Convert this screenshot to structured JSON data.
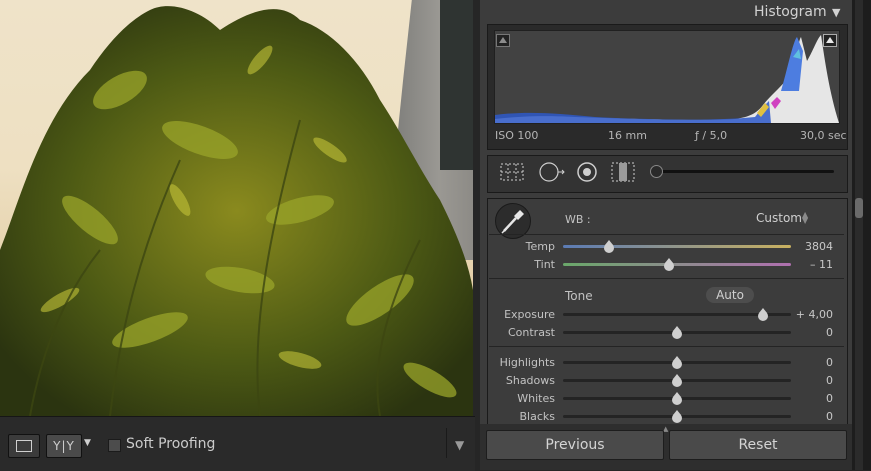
{
  "filmstrip_bar": {
    "loupe_icon": "loupe-view-icon",
    "compare_label": "Y|Y",
    "soft_proofing_label": "Soft Proofing",
    "soft_proofing_checked": false
  },
  "histogram": {
    "title": "Histogram",
    "iso": "ISO 100",
    "focal_length": "16 mm",
    "aperture": "ƒ / 5,0",
    "shutter": "30,0 sec"
  },
  "basic": {
    "wb_label": "WB :",
    "wb_value": "Custom",
    "sliders_wb": [
      {
        "label": "Temp",
        "value": "3804",
        "position": 0.2
      },
      {
        "label": "Tint",
        "value": "– 11",
        "position": 0.46
      }
    ],
    "tone_label": "Tone",
    "auto_label": "Auto",
    "sliders_tone1": [
      {
        "label": "Exposure",
        "value": "+ 4,00",
        "position": 0.88
      },
      {
        "label": "Contrast",
        "value": "0",
        "position": 0.5
      }
    ],
    "sliders_tone2": [
      {
        "label": "Highlights",
        "value": "0",
        "position": 0.5
      },
      {
        "label": "Shadows",
        "value": "0",
        "position": 0.5
      },
      {
        "label": "Whites",
        "value": "0",
        "position": 0.5
      },
      {
        "label": "Blacks",
        "value": "0",
        "position": 0.5
      }
    ]
  },
  "buttons": {
    "previous": "Previous",
    "reset": "Reset"
  },
  "colors": {
    "panel_bg": "#3c3c3c",
    "histogram_blue": "#3a6fd8",
    "temp_gradient": [
      "#5b7bb5",
      "#c9b160"
    ],
    "tint_gradient": [
      "#6aa86a",
      "#b070b0"
    ]
  }
}
